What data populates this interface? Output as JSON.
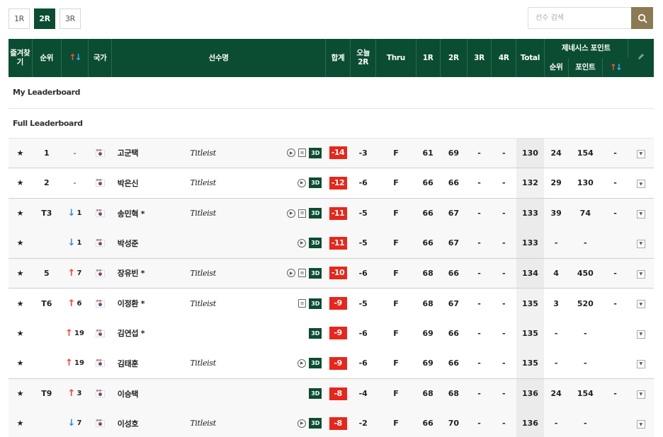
{
  "rounds": {
    "tabs": [
      "1R",
      "2R",
      "3R"
    ],
    "active": "2R"
  },
  "search": {
    "placeholder": "선수 검색"
  },
  "header": {
    "fav": "즐겨찾기",
    "rank": "순위",
    "move_arrows": "↑↓",
    "country": "국가",
    "player": "선수명",
    "total_score": "합계",
    "today": "오늘 2R",
    "thru": "Thru",
    "r1": "1R",
    "r2": "2R",
    "r3": "3R",
    "r4": "4R",
    "total": "Total",
    "genesis": "제네시스 포인트",
    "g_rank": "순위",
    "g_points": "포인트",
    "g_arrows": "↑↓",
    "tool_icon": "pencil-icon"
  },
  "sections": {
    "my": "My Leaderboard",
    "full": "Full Leaderboard"
  },
  "players": [
    {
      "rank": "1",
      "move": "-",
      "move_dir": "",
      "name": "고군택",
      "brand": "Titleist",
      "media": [
        "play",
        "card",
        "3d"
      ],
      "score": "-14",
      "today": "-3",
      "thru": "F",
      "r1": "61",
      "r2": "69",
      "r3": "-",
      "r4": "-",
      "total": "130",
      "g_rank": "24",
      "g_points": "154",
      "g_move": "-"
    },
    {
      "rank": "2",
      "move": "-",
      "move_dir": "",
      "name": "박은신",
      "brand": "Titleist",
      "media": [
        "play",
        "3d"
      ],
      "score": "-12",
      "today": "-6",
      "thru": "F",
      "r1": "66",
      "r2": "66",
      "r3": "-",
      "r4": "-",
      "total": "132",
      "g_rank": "29",
      "g_points": "130",
      "g_move": "-"
    },
    {
      "rank": "T3",
      "move": "1",
      "move_dir": "down",
      "name": "송민혁 *",
      "brand": "Titleist",
      "media": [
        "play",
        "card",
        "3d"
      ],
      "score": "-11",
      "today": "-5",
      "thru": "F",
      "r1": "66",
      "r2": "67",
      "r3": "-",
      "r4": "-",
      "total": "133",
      "g_rank": "39",
      "g_points": "74",
      "g_move": "-"
    },
    {
      "rank": "",
      "move": "1",
      "move_dir": "down",
      "name": "박성준",
      "brand": "",
      "media": [
        "play",
        "3d"
      ],
      "score": "-11",
      "today": "-5",
      "thru": "F",
      "r1": "66",
      "r2": "67",
      "r3": "-",
      "r4": "-",
      "total": "133",
      "g_rank": "-",
      "g_points": "-",
      "g_move": ""
    },
    {
      "rank": "5",
      "move": "7",
      "move_dir": "up",
      "name": "장유빈 *",
      "brand": "Titleist",
      "media": [
        "play",
        "card",
        "3d"
      ],
      "score": "-10",
      "today": "-6",
      "thru": "F",
      "r1": "68",
      "r2": "66",
      "r3": "-",
      "r4": "-",
      "total": "134",
      "g_rank": "4",
      "g_points": "450",
      "g_move": "-"
    },
    {
      "rank": "T6",
      "move": "6",
      "move_dir": "up",
      "name": "이정환 *",
      "brand": "Titleist",
      "media": [
        "card",
        "3d"
      ],
      "score": "-9",
      "today": "-5",
      "thru": "F",
      "r1": "68",
      "r2": "67",
      "r3": "-",
      "r4": "-",
      "total": "135",
      "g_rank": "3",
      "g_points": "520",
      "g_move": "-"
    },
    {
      "rank": "",
      "move": "19",
      "move_dir": "up",
      "name": "김연섭 *",
      "brand": "",
      "media": [
        "3d"
      ],
      "score": "-9",
      "today": "-6",
      "thru": "F",
      "r1": "69",
      "r2": "66",
      "r3": "-",
      "r4": "-",
      "total": "135",
      "g_rank": "-",
      "g_points": "-",
      "g_move": ""
    },
    {
      "rank": "",
      "move": "19",
      "move_dir": "up",
      "name": "김태훈",
      "brand": "Titleist",
      "media": [
        "play",
        "3d"
      ],
      "score": "-9",
      "today": "-6",
      "thru": "F",
      "r1": "69",
      "r2": "66",
      "r3": "-",
      "r4": "-",
      "total": "135",
      "g_rank": "-",
      "g_points": "-",
      "g_move": ""
    },
    {
      "rank": "T9",
      "move": "3",
      "move_dir": "up",
      "name": "이승택",
      "brand": "",
      "media": [
        "3d"
      ],
      "score": "-8",
      "today": "-4",
      "thru": "F",
      "r1": "68",
      "r2": "68",
      "r3": "-",
      "r4": "-",
      "total": "136",
      "g_rank": "24",
      "g_points": "154",
      "g_move": "-"
    },
    {
      "rank": "",
      "move": "7",
      "move_dir": "down",
      "name": "이성호",
      "brand": "Titleist",
      "media": [
        "play",
        "3d"
      ],
      "score": "-8",
      "today": "-2",
      "thru": "F",
      "r1": "66",
      "r2": "70",
      "r3": "-",
      "r4": "-",
      "total": "136",
      "g_rank": "-",
      "g_points": "-",
      "g_move": ""
    }
  ],
  "colors": {
    "header_bg": "#0b4d32",
    "score_red": "#e8261b",
    "up": "#ff3b30",
    "down": "#2d8cf0",
    "search_btn": "#8b7a52"
  }
}
